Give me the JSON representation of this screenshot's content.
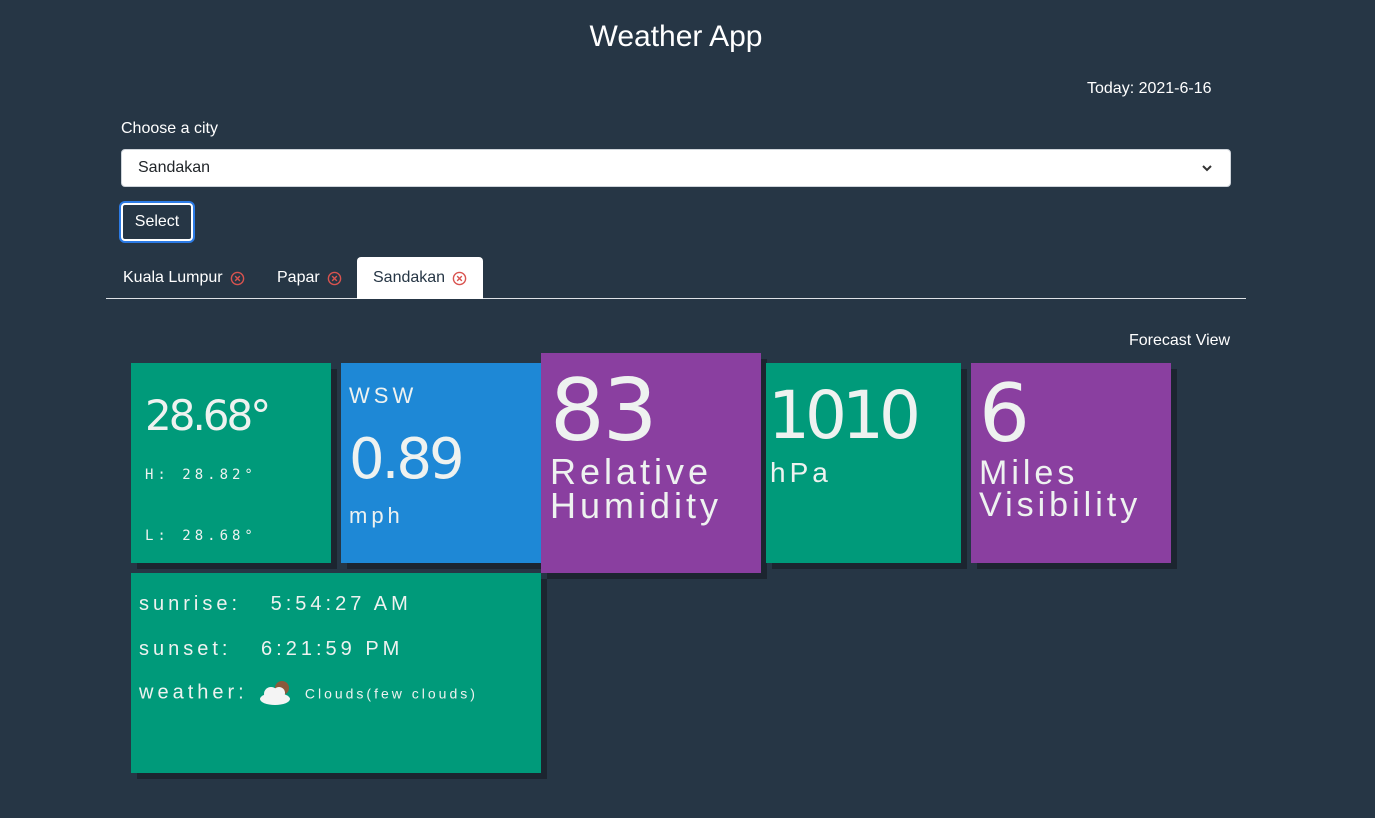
{
  "header": {
    "title": "Weather App",
    "today": "Today: 2021-6-16"
  },
  "form": {
    "label": "Choose a city",
    "selected_city": "Sandakan",
    "select_button": "Select"
  },
  "tabs": [
    {
      "label": "Kuala Lumpur",
      "active": false
    },
    {
      "label": "Papar",
      "active": false
    },
    {
      "label": "Sandakan",
      "active": true
    }
  ],
  "forecast_link": "Forecast View",
  "temperature": {
    "current": "28.68°",
    "high": "H: 28.82°",
    "low": "L: 28.68°"
  },
  "wind": {
    "direction": "WSW",
    "speed": "0.89",
    "unit": "mph"
  },
  "humidity": {
    "value": "83",
    "label_line1": "Relative",
    "label_line2": "Humidity"
  },
  "pressure": {
    "value": "1010",
    "unit": "hPa"
  },
  "visibility": {
    "value": "6",
    "label_line1": "Miles",
    "label_line2": "Visibility"
  },
  "sun": {
    "sunrise_label": "sunrise:",
    "sunrise": "5:54:27 AM",
    "sunset_label": "sunset:",
    "sunset": "6:21:59 PM",
    "weather_label": "weather:",
    "weather": "Clouds(few clouds)",
    "weather_icon": "cloud-sun-icon"
  },
  "colors": {
    "background": "#263645",
    "green_tile": "#009a7a",
    "blue_tile": "#1e88d6",
    "purple_tile": "#8a3fa0",
    "close_icon": "#d9534f"
  }
}
